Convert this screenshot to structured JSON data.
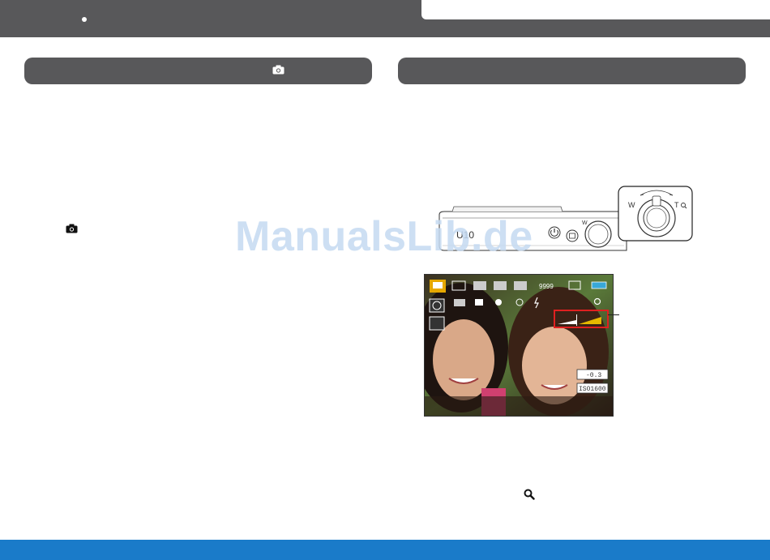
{
  "watermark": "ManualsLib.de",
  "camera_body": {
    "model_label": "U10",
    "zoom_wide_label": "W",
    "zoom_tele_label": "T"
  },
  "lcd_screen": {
    "shots_remaining": "9999",
    "exposure_value": "-0.3",
    "iso_value": "ISO1600"
  },
  "icons": {
    "left_header_icon": "camera-icon",
    "left_body_icon": "camera-icon",
    "zoom_icon": "magnifier-icon"
  },
  "colors": {
    "header_bar": "#58585a",
    "footer_bar": "#1a7bc9",
    "zoom_highlight": "#e02020",
    "zoom_fill": "#e6b800"
  }
}
